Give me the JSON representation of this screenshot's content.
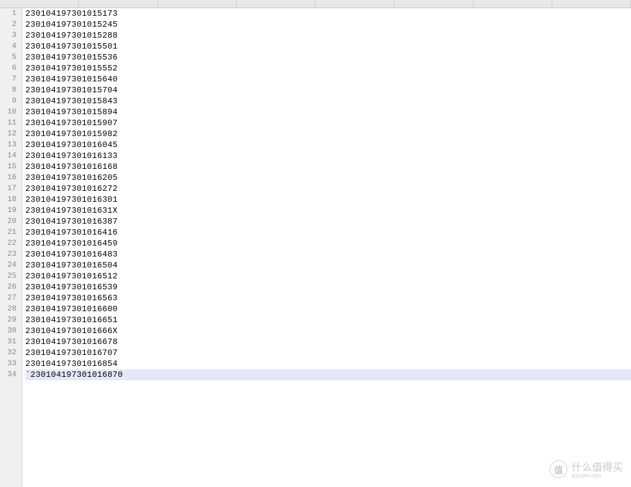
{
  "editor": {
    "current_line": 34,
    "lines": [
      {
        "num": 1,
        "text": "230104197301015173"
      },
      {
        "num": 2,
        "text": "230104197301015245"
      },
      {
        "num": 3,
        "text": "230104197301015288"
      },
      {
        "num": 4,
        "text": "230104197301015501"
      },
      {
        "num": 5,
        "text": "230104197301015536"
      },
      {
        "num": 6,
        "text": "230104197301015552"
      },
      {
        "num": 7,
        "text": "230104197301015640"
      },
      {
        "num": 8,
        "text": "230104197301015704"
      },
      {
        "num": 9,
        "text": "230104197301015843"
      },
      {
        "num": 10,
        "text": "230104197301015894"
      },
      {
        "num": 11,
        "text": "230104197301015907"
      },
      {
        "num": 12,
        "text": "230104197301015982"
      },
      {
        "num": 13,
        "text": "230104197301016045"
      },
      {
        "num": 14,
        "text": "230104197301016133"
      },
      {
        "num": 15,
        "text": "230104197301016168"
      },
      {
        "num": 16,
        "text": "230104197301016205"
      },
      {
        "num": 17,
        "text": "230104197301016272"
      },
      {
        "num": 18,
        "text": "230104197301016301"
      },
      {
        "num": 19,
        "text": "23010419730101631X"
      },
      {
        "num": 20,
        "text": "230104197301016387"
      },
      {
        "num": 21,
        "text": "230104197301016416"
      },
      {
        "num": 22,
        "text": "230104197301016459"
      },
      {
        "num": 23,
        "text": "230104197301016483"
      },
      {
        "num": 24,
        "text": "230104197301016504"
      },
      {
        "num": 25,
        "text": "230104197301016512"
      },
      {
        "num": 26,
        "text": "230104197301016539"
      },
      {
        "num": 27,
        "text": "230104197301016563"
      },
      {
        "num": 28,
        "text": "230104197301016600"
      },
      {
        "num": 29,
        "text": "230104197301016651"
      },
      {
        "num": 30,
        "text": "23010419730101666X"
      },
      {
        "num": 31,
        "text": "230104197301016678"
      },
      {
        "num": 32,
        "text": "230104197301016707"
      },
      {
        "num": 33,
        "text": "230104197301016854"
      },
      {
        "num": 34,
        "text": "`230104197301016870"
      }
    ]
  },
  "watermark": {
    "circle_text": "值",
    "main_text": "什么值得买",
    "sub_text": "smzdm.com"
  }
}
